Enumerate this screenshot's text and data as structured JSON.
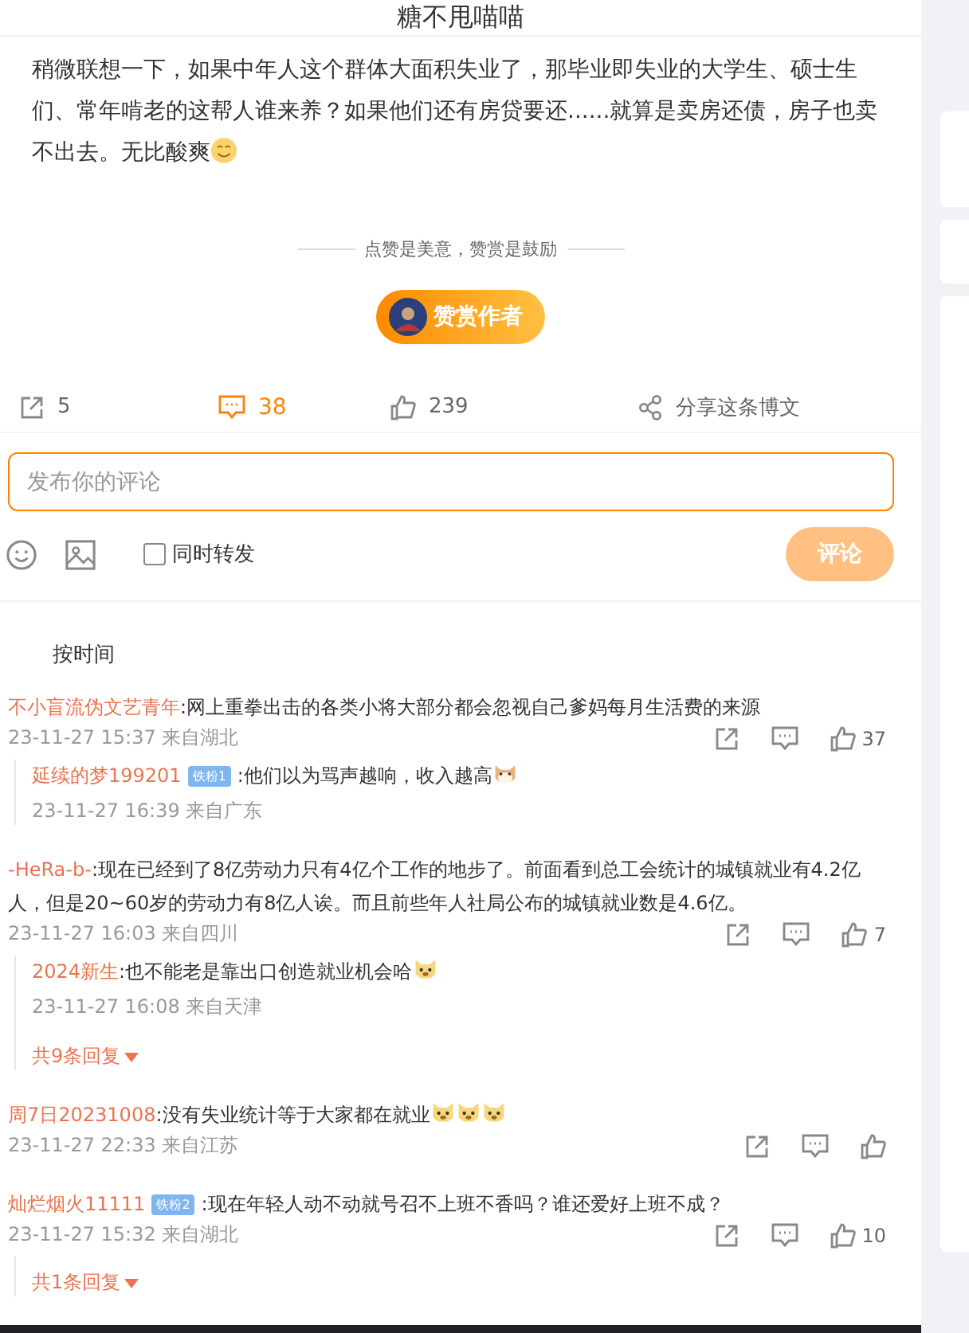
{
  "header": {
    "title": "糖不甩喵喵"
  },
  "post": {
    "text": "稍微联想一下，如果中年人这个群体大面积失业了，那毕业即失业的大学生、硕士生们、常年啃老的这帮人谁来养？如果他们还有房贷要还......就算是卖房还债，房子也卖不出去。无比酸爽",
    "emojis": [
      {
        "kind": "smile"
      }
    ]
  },
  "reward": {
    "note": "点赞是美意，赞赏是鼓励",
    "button": "赞赏作者"
  },
  "actions": [
    {
      "kind": "repost",
      "count": "5",
      "selected": false
    },
    {
      "kind": "comment",
      "count": "38",
      "selected": true
    },
    {
      "kind": "like",
      "count": "239",
      "selected": false
    },
    {
      "kind": "share",
      "count": "分享这条博文",
      "selected": false
    }
  ],
  "composer": {
    "placeholder": "发布你的评论",
    "repost_label": "同时转发",
    "repost_checked": false,
    "submit": "评论",
    "submit_disabled": true
  },
  "sort_tabs": [
    {
      "label": "按时间",
      "selected": false
    }
  ],
  "comments": [
    {
      "user": "不小盲流伪文艺青年",
      "text": ":网上重拳出击的各类小将大部分都会忽视自己爹妈每月生活费的来源",
      "meta": "23-11-27 15:37 来自湖北",
      "likes": "37",
      "replies": [
        {
          "user": "延续的梦199201",
          "badge": "铁粉1",
          "text": ":他们以为骂声越响，收入越高",
          "emojis": [
            {
              "kind": "cat"
            }
          ],
          "meta": "23-11-27 16:39 来自广东"
        }
      ]
    },
    {
      "user": "-HeRa-b-",
      "text": ":现在已经到了8亿劳动力只有4亿个工作的地步了。前面看到总工会统计的城镇就业有4.2亿人，但是20~60岁的劳动力有8亿人诶。而且前些年人社局公布的城镇就业数是4.6亿。",
      "meta": "23-11-27 16:03 来自四川",
      "likes": "7",
      "replies": [
        {
          "user": "2024新生",
          "text": ":也不能老是靠出口创造就业机会哈",
          "emojis": [
            {
              "kind": "dog"
            }
          ],
          "meta": "23-11-27 16:08 来自天津"
        }
      ],
      "more": "共9条回复"
    },
    {
      "user": "周7日20231008",
      "text": ":没有失业统计等于大家都在就业",
      "emojis": [
        {
          "kind": "dog"
        },
        {
          "kind": "dog"
        },
        {
          "kind": "dog"
        }
      ],
      "meta": "23-11-27 22:33 来自江苏"
    },
    {
      "user": "灿烂烟火11111",
      "badge": "铁粉2",
      "text": ":现在年轻人动不动就号召不上班不香吗？谁还爱好上班不成？",
      "meta": "23-11-27 15:32 来自湖北",
      "likes": "10",
      "more": "共1条回复"
    }
  ]
}
